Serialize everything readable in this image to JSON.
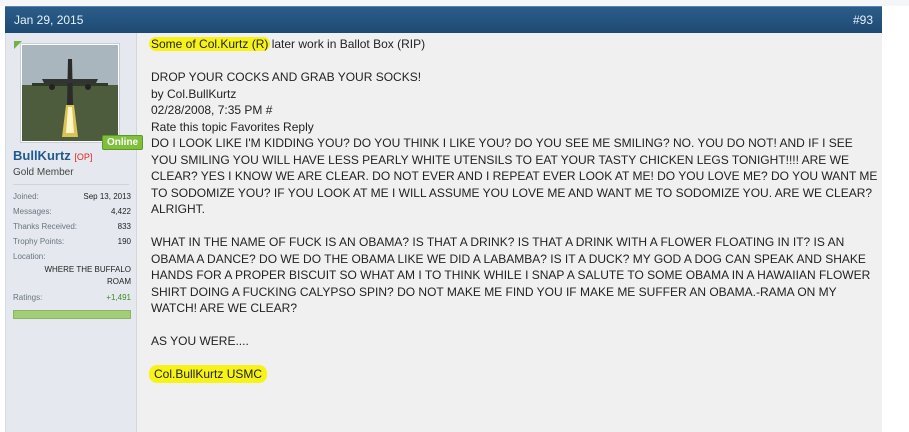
{
  "post": {
    "date": "Jan 29, 2015",
    "number": "#93"
  },
  "user": {
    "name": "BullKurtz",
    "op_badge": "[OP]",
    "title": "Gold Member",
    "online": "Online",
    "stats": [
      {
        "label": "Joined:",
        "value": "Sep 13, 2013"
      },
      {
        "label": "Messages:",
        "value": "4,422"
      },
      {
        "label": "Thanks Received:",
        "value": "833"
      },
      {
        "label": "Trophy Points:",
        "value": "190"
      }
    ],
    "location_label": "Location:",
    "location_value_1": "WHERE THE BUFFALO",
    "location_value_2": "ROAM",
    "ratings_label": "Ratings:",
    "ratings_value": "+1,491"
  },
  "content": {
    "intro_hl": "Some of Col.Kurtz (R)",
    "intro_rest": " later work in Ballot Box (RIP)",
    "headline": "DROP YOUR COCKS AND GRAB YOUR SOCKS!",
    "byline": "by Col.BullKurtz",
    "timestamp": "02/28/2008, 7:35 PM #",
    "actions": "Rate this topic Favorites Reply",
    "para1": "DO I LOOK LIKE I'M KIDDING YOU? DO YOU THINK I LIKE YOU? DO YOU SEE ME SMILING? NO. YOU DO NOT! AND IF I SEE YOU SMILING YOU WILL HAVE LESS PEARLY WHITE UTENSILS TO EAT YOUR TASTY CHICKEN LEGS TONIGHT!!!! ARE WE CLEAR? YES I KNOW WE ARE CLEAR. DO NOT EVER AND I REPEAT EVER LOOK AT ME! DO YOU LOVE ME? DO YOU WANT ME TO SODOMIZE YOU? IF YOU LOOK AT ME I WILL ASSUME YOU LOVE ME AND WANT ME TO SODOMIZE YOU. ARE WE CLEAR? ALRIGHT.",
    "para2": "WHAT IN THE NAME OF FUCK IS AN OBAMA? IS THAT A DRINK? IS THAT A DRINK WITH A FLOWER FLOATING IN IT? IS AN OBAMA A DANCE? DO WE DO THE OBAMA LIKE WE DID A LABAMBA? IS IT A DUCK? MY GOD A DOG CAN SPEAK AND SHAKE HANDS FOR A PROPER BISCUIT SO WHAT AM I TO THINK WHILE I SNAP A SALUTE TO SOME OBAMA IN A HAWAIIAN FLOWER SHIRT DOING A FUCKING CALYPSO SPIN? DO NOT MAKE ME FIND YOU IF MAKE ME SUFFER AN OBAMA.-RAMA ON MY WATCH! ARE WE CLEAR?",
    "closing": "AS YOU WERE....",
    "signature": "Col.BullKurtz USMC"
  },
  "colors": {
    "header_bg": "#245482",
    "highlight": "#f7f316",
    "username": "#1f5a8d",
    "online": "#7fbf3a"
  }
}
